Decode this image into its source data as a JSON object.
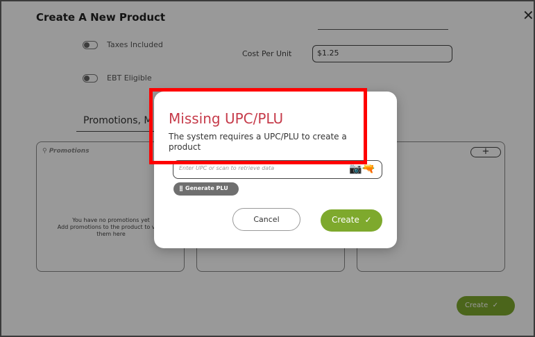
{
  "window": {
    "title": "Create A New Product",
    "close_glyph": "✕"
  },
  "form": {
    "taxes_label": "Taxes Included",
    "ebt_label": "EBT Eligible",
    "cost_per_unit_label": "Cost Per Unit",
    "cost_per_unit_value": "$1.25",
    "section_title": "Promotions, M"
  },
  "promotions_panel": {
    "title": "Promotions",
    "empty_line1": "You have no promotions yet",
    "empty_line2": "Add promotions to the product to view",
    "empty_line3": "them here"
  },
  "add_button": {
    "label": "+"
  },
  "background_create": {
    "label": "Create",
    "check": "✓"
  },
  "dialog": {
    "title": "Missing UPC/PLU",
    "message": "The system requires a UPC/PLU to create a product",
    "upc_placeholder": "Enter UPC or scan to retrieve data",
    "generate_plu_label": "Generate PLU",
    "cancel_label": "Cancel",
    "create_label": "Create",
    "check": "✓"
  },
  "colors": {
    "accent_green": "#7ea92d",
    "dialog_title": "#c63b4a",
    "highlight": "#ff0000"
  },
  "icons": [
    "close-icon",
    "toggle-icon",
    "promotions-icon",
    "camera-icon",
    "scanner-icon",
    "barcode-icon",
    "check-icon"
  ]
}
